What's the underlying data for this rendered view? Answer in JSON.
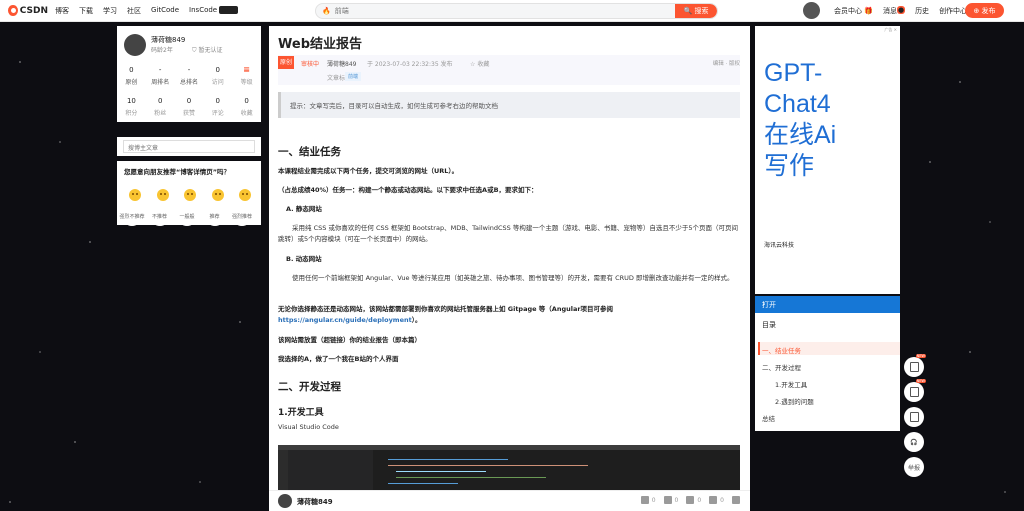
{
  "topbar": {
    "logo": "CSDN",
    "nav": [
      "博客",
      "下载",
      "学习",
      "社区",
      "GitCode",
      "InsCode"
    ],
    "nav_chip": "GPU",
    "search_placeholder": "前端",
    "search_button": "搜索",
    "right_items": [
      "会员中心",
      "消息",
      "历史",
      "创作中心"
    ],
    "vip_badge": "🎁",
    "publish": "发布"
  },
  "profile": {
    "name": "薄荷糖849",
    "years": "码龄2年",
    "auth": "暂无认证",
    "stats_row1": [
      {
        "value": "0",
        "label": "原创"
      },
      {
        "value": "-",
        "label": "周排名"
      },
      {
        "value": "-",
        "label": "总排名"
      },
      {
        "value": "0",
        "label": "访问"
      },
      {
        "value": "",
        "label": "等级"
      }
    ],
    "stats_row2": [
      {
        "value": "10",
        "label": "积分"
      },
      {
        "value": "0",
        "label": "粉丝"
      },
      {
        "value": "0",
        "label": "获赞"
      },
      {
        "value": "0",
        "label": "评论"
      },
      {
        "value": "0",
        "label": "收藏"
      }
    ]
  },
  "blog_search": "搜博主文章",
  "vote": {
    "title": "您愿意向朋友推荐“博客详情页”吗？",
    "options": [
      "强烈不推荐",
      "不推荐",
      "一般般",
      "推荐",
      "强烈推荐"
    ]
  },
  "article": {
    "title": "Web结业报告",
    "original_tag": "原创",
    "status": "审核中",
    "author": "薄荷糖849",
    "date": "于 2023-07-03 22:32:35 发布",
    "favorite": "收藏",
    "edit": "编辑 · 版权",
    "tags_label": "文章标签：",
    "tag": "前端",
    "tip": "提示：文章写完后，目录可以自动生成，如何生成可参考右边的帮助文档",
    "h_task": "一、结业任务",
    "p1": "本课程结业需完成以下两个任务，提交可浏览的网址（URL）。",
    "p2": "（占总成绩40%）任务一：构建一个静态或动态网站。以下要求中任选A或B，要求如下：",
    "pA": "A. 静态网站",
    "pA_text": "采用纯 CSS 或你喜欢的任何 CSS 框架如 Bootstrap、MDB、TailwindCSS 等构建一个主题（游戏、电影、书籍、宠物等）自选且不少于5个页面（可页间跳转）或5个内容模块（可在一个长页面中）的网站。",
    "pB": "B. 动态网站",
    "pB_text": "使用任何一个前端框架如 Angular、Vue 等进行某应用（如英雄之旅、待办事项、图书管理等）的开发，需要有 CRUD 即增删改查功能并有一定的样式。",
    "p3_a": "无论你选择静态还是动态网站，该网站都需部署到你喜欢的网站托管服务器上如 Gitpage 等（Angular项目可参阅 ",
    "p3_link": "https://angular.cn/guide/deployment",
    "p3_b": "）。",
    "p4": "该网站需放置（超链接）你的结业报告（即本篇）",
    "p5": "我选择的A，做了一个我在B站的个人界面",
    "h_dev": "二、开发过程",
    "h_tools": "1.开发工具",
    "p6": "Visual Studio Code"
  },
  "bottombar": {
    "name": "薄荷糖849",
    "actions": [
      "0",
      "0",
      "0",
      "0"
    ]
  },
  "ad": {
    "flag": "广告 ✕",
    "headline": [
      "GPT-",
      "Chat4",
      "在线Ai",
      "写作"
    ],
    "brand": "海讯云科技"
  },
  "toc": {
    "open": "打开",
    "title": "目录",
    "items": [
      "一、结业任务",
      "二、开发过程",
      "1.开发工具",
      "2.遇到的问题",
      "总结"
    ]
  },
  "floaters": [
    "NEW",
    "NEW",
    "",
    "",
    "举报"
  ]
}
